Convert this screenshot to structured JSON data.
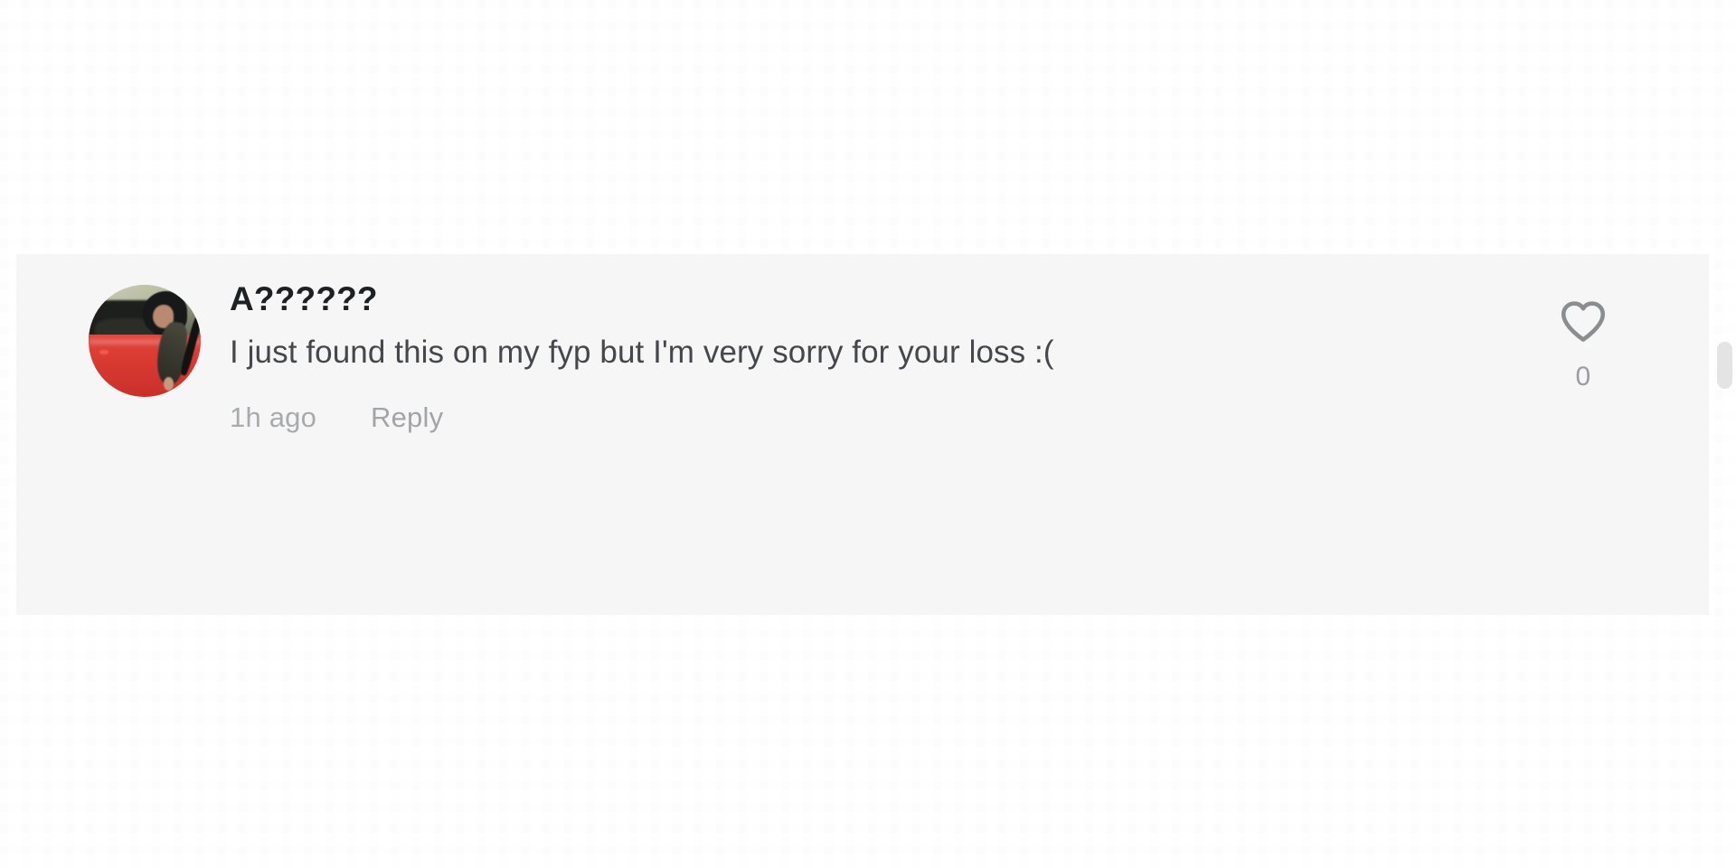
{
  "page": {
    "background_color": "#ffffff",
    "card_background_color": "#f6f6f6"
  },
  "comment": {
    "username": "A??????",
    "avatar_alt": "profile photo of a person leaning on a red car",
    "text": "I just found this on my fyp but I'm very sorry for your loss :(",
    "timestamp": "1h ago",
    "reply_label": "Reply",
    "like_count": "0",
    "like_icon": "heart-outline-icon",
    "liked": false,
    "colors": {
      "username": "#1f2023",
      "body_text": "#45474c",
      "meta_text": "#a8aaad",
      "heart_stroke": "#8b8d91",
      "like_count": "#9b9da1"
    }
  },
  "scrollbar": {
    "thumb_color": "#e4e4e4",
    "position": "upper"
  }
}
